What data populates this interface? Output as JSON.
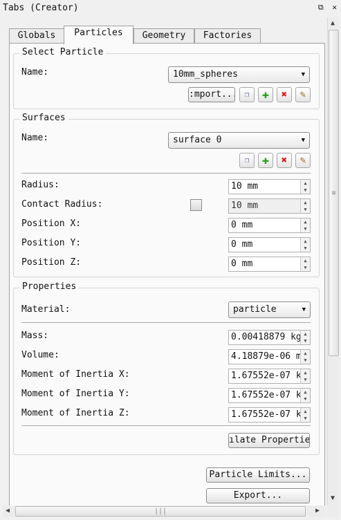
{
  "window": {
    "title": "Tabs (Creator)",
    "float_glyph": "⧉",
    "close_glyph": "✕"
  },
  "tabs": [
    {
      "label": "Globals",
      "active": false
    },
    {
      "label": "Particles",
      "active": true
    },
    {
      "label": "Geometry",
      "active": false
    },
    {
      "label": "Factories",
      "active": false
    }
  ],
  "select_particle": {
    "title": "Select Particle",
    "name_label": "Name:",
    "name_value": "10mm_spheres",
    "import_label": ":mport..."
  },
  "surfaces": {
    "title": "Surfaces",
    "name_label": "Name:",
    "name_value": "surface 0",
    "fields": [
      {
        "label": "Radius:",
        "value": "10 mm",
        "disabled": false
      },
      {
        "label": "Contact Radius:",
        "value": "10 mm",
        "disabled": true,
        "checkbox": false
      },
      {
        "label": "Position X:",
        "value": "0 mm",
        "disabled": false
      },
      {
        "label": "Position Y:",
        "value": "0 mm",
        "disabled": false
      },
      {
        "label": "Position Z:",
        "value": "0 mm",
        "disabled": false
      }
    ]
  },
  "properties": {
    "title": "Properties",
    "material_label": "Material:",
    "material_value": "particle",
    "fields": [
      {
        "label": "Mass:",
        "value": "0.00418879 kg"
      },
      {
        "label": "Volume:",
        "value": "4.18879e-06 m"
      },
      {
        "label": "Moment of Inertia X:",
        "value": "1.67552e-07 k"
      },
      {
        "label": "Moment of Inertia Y:",
        "value": "1.67552e-07 k"
      },
      {
        "label": "Moment of Inertia Z:",
        "value": "1.67552e-07 k"
      }
    ],
    "calculate_label": "ılate Propertie"
  },
  "footer": {
    "particle_limits_label": "Particle Limits...",
    "export_label": "Export..."
  },
  "icons": {
    "add": "✚",
    "delete": "✖",
    "edit": "✎",
    "copy": "❐",
    "dropdown": "▼",
    "up": "▲",
    "down": "▼",
    "left": "◀",
    "right": "▶",
    "grip_v": "≡",
    "grip_h": "|||"
  },
  "colors": {
    "add_icon": "#2e9a22",
    "delete_icon": "#d42020",
    "edit_icon": "#a06a10"
  }
}
